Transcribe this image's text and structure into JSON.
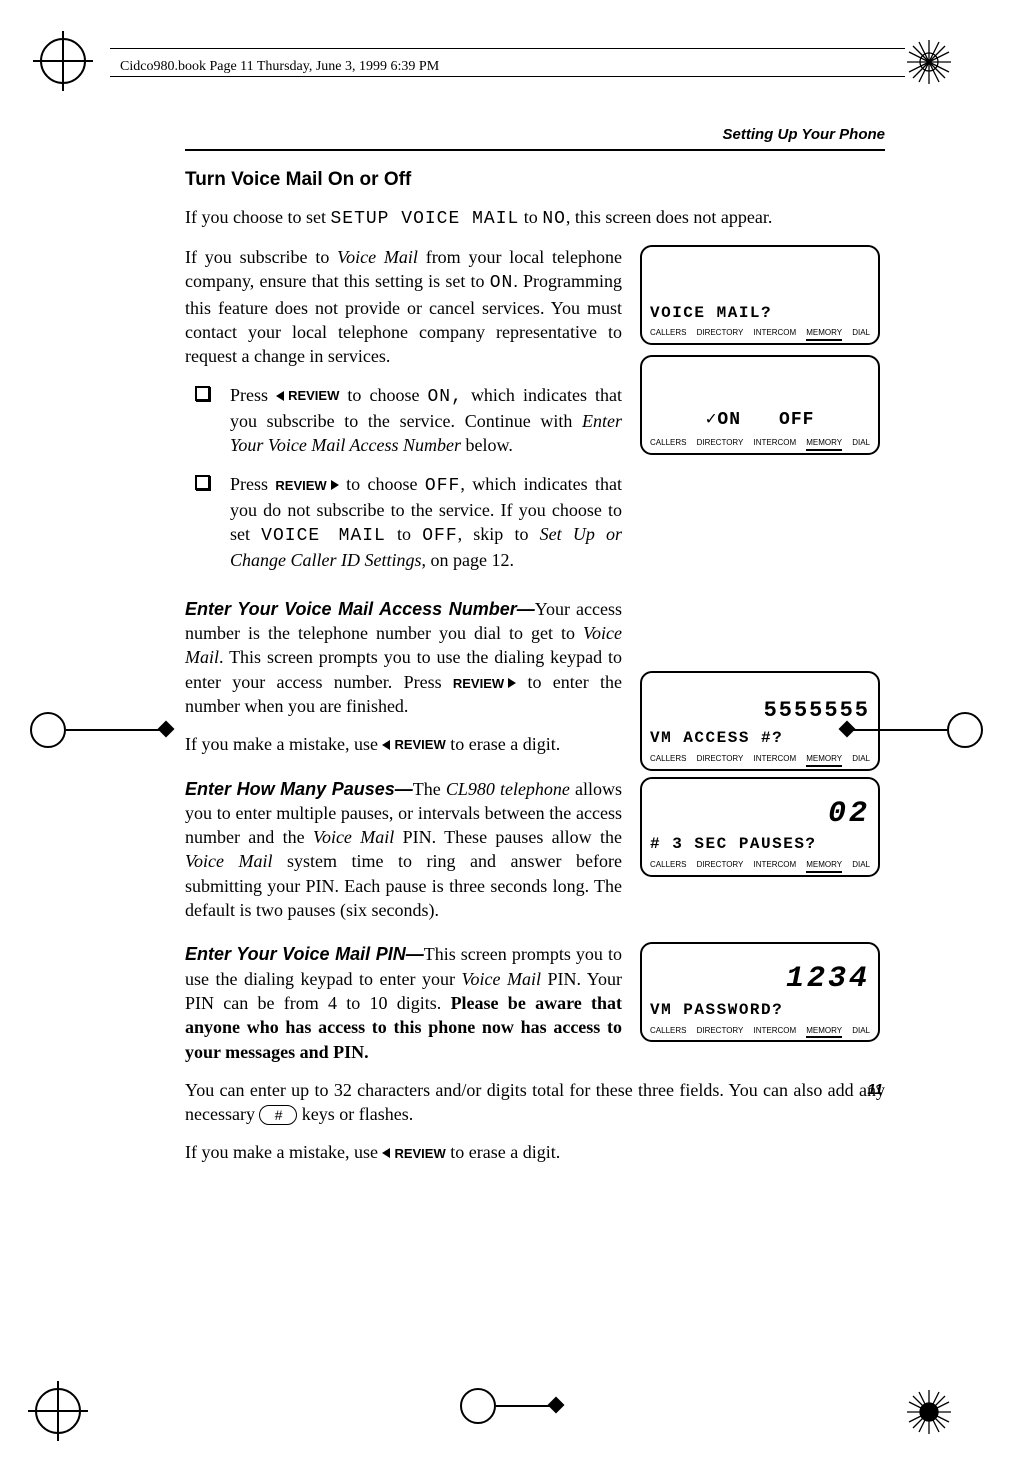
{
  "header_note": "Cidco980.book  Page 11  Thursday, June 3, 1999  6:39 PM",
  "running_head": "Setting Up Your Phone",
  "section_title": "Turn Voice Mail On or Off",
  "p_intro_a": "If you choose to set ",
  "mono_setup": "SETUP VOICE MAIL",
  "p_intro_b": " to ",
  "mono_no": "NO",
  "p_intro_c": ", this screen does not appear.",
  "p_subscribe_a": "If you subscribe to ",
  "ital_vm": "Voice Mail",
  "p_subscribe_b": " from your local telephone company, ensure that this setting is set to ",
  "mono_on": "ON",
  "p_subscribe_c": ". Programming this feature does not provide or cancel services. You must contact your local telephone company representative to request a change in services.",
  "b1_a": "Press ",
  "btn_review": "REVIEW",
  "b1_b": " to choose ",
  "mono_on_comma": "ON,",
  "b1_c": " which indicates that you subscribe to the service. Continue with ",
  "b1_ital": "Enter Your Voice Mail Access Number",
  "b1_d": " below.",
  "b2_a": "Press ",
  "b2_b": " to choose ",
  "mono_off": "OFF",
  "b2_c": ", which indicates that you do not subscribe to the service. If you choose to set ",
  "mono_vm": "VOICE MAIL",
  "b2_d": " to ",
  "b2_e": ", skip to ",
  "b2_ital": "Set Up or Change Caller ID Settings",
  "b2_f": ", on page 12.",
  "sh_access": "Enter Your Voice Mail Access Number—",
  "p_access_a": "Your access number is the telephone number you dial to get to ",
  "p_access_b": ". This screen prompts you to use the dialing keypad to enter your access number. Press ",
  "p_access_c": " to enter the number when you are finished.",
  "p_mistake_a": "If you make a mistake, use ",
  "p_mistake_b": " to erase a digit.",
  "sh_pauses": "Enter How Many Pauses—",
  "p_pauses_a": "The ",
  "ital_cl980": "CL980 telephone",
  "p_pauses_b": " allows you to enter multiple pauses, or intervals between the access number and the ",
  "p_pauses_c": " PIN. These pauses allow the ",
  "p_pauses_d": " system time to ring and answer before submitting your PIN. Each pause is three seconds long. The default is two pauses (six seconds).",
  "sh_pin": "Enter Your Voice Mail PIN—",
  "p_pin_a": "This screen prompts you to use the dialing keypad to enter your ",
  "p_pin_b": " PIN. Your PIN can be from 4 to 10 digits. ",
  "p_pin_bold": "Please be aware that anyone who has access to this phone now has access to your messages and PIN.",
  "p_32_a": "You can enter up to 32 characters and/or digits total for these three fields. You can also add any necessary ",
  "key_hash": "#",
  "p_32_b": " keys or flashes.",
  "page_num": "11",
  "screens": {
    "s1_prompt": "VOICE MAIL?",
    "s2_on": "✓ON",
    "s2_off": "OFF",
    "s3_big": "5555555",
    "s3_prompt": "VM ACCESS #?",
    "s4_big": "02",
    "s4_prompt": "# 3 SEC PAUSES?",
    "s5_big": "1234",
    "s5_prompt": "VM PASSWORD?",
    "menu": {
      "callers": "CALLERS",
      "directory": "DIRECTORY",
      "intercom": "INTERCOM",
      "memory": "MEMORY",
      "dial": "DIAL"
    }
  }
}
